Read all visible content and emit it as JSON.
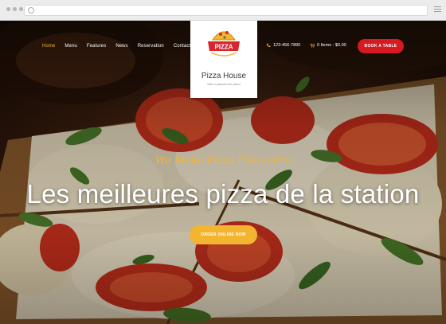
{
  "browser": {
    "address_value": ""
  },
  "nav": {
    "items": [
      {
        "label": "Home",
        "active": true
      },
      {
        "label": "Menu"
      },
      {
        "label": "Features"
      },
      {
        "label": "News"
      },
      {
        "label": "Reservation"
      },
      {
        "label": "Contacts"
      }
    ]
  },
  "logo": {
    "badge_text": "PIZZA",
    "name": "Pizza House",
    "tagline": "with a passion for pizza"
  },
  "header": {
    "phone": "123-456-7890",
    "cart": "0 Items - $0.00",
    "book_button": "BOOK A TABLE"
  },
  "hero": {
    "tagline": "We Make Pizza Like a Pro",
    "headline": "Les meilleures pizza de la station",
    "order_button": "ORDER ONLINE NOW"
  },
  "colors": {
    "accent_yellow": "#f3b530",
    "book_red": "#d71921",
    "logo_red": "#d7262e"
  }
}
